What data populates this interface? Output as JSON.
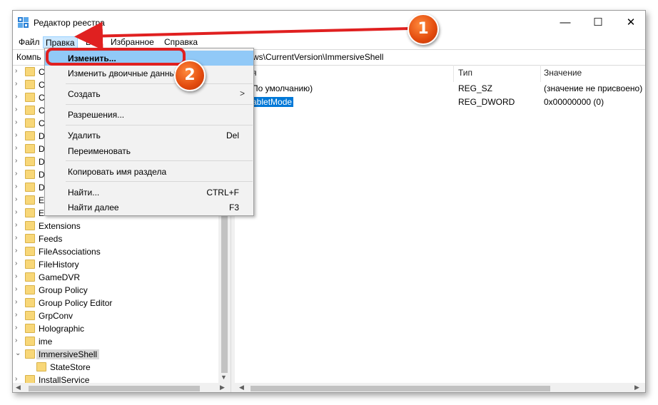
{
  "window": {
    "title": "Редактор реестра",
    "controls": {
      "minimize": "—",
      "maximize": "☐",
      "close": "✕"
    }
  },
  "menu": {
    "items": [
      "Файл",
      "Правка",
      "Вид",
      "Избранное",
      "Справка"
    ],
    "active": "Правка"
  },
  "address": {
    "label": "Компь",
    "path": "ws\\CurrentVersion\\ImmersiveShell"
  },
  "tree": {
    "partial_labels": [
      "C",
      "C",
      "C",
      "C",
      "C",
      "D",
      "D",
      "D",
      "D",
      "D",
      "E",
      "E"
    ],
    "items": [
      {
        "label": "Extensions",
        "expanded": false
      },
      {
        "label": "Feeds",
        "expanded": false
      },
      {
        "label": "FileAssociations",
        "expanded": false
      },
      {
        "label": "FileHistory",
        "expanded": false
      },
      {
        "label": "GameDVR",
        "expanded": false
      },
      {
        "label": "Group Policy",
        "expanded": false
      },
      {
        "label": "Group Policy Editor",
        "expanded": false
      },
      {
        "label": "GrpConv",
        "expanded": false
      },
      {
        "label": "Holographic",
        "expanded": false
      },
      {
        "label": "ime",
        "expanded": false
      },
      {
        "label": "ImmersiveShell",
        "expanded": true,
        "selected": true
      },
      {
        "label": "StateStore",
        "child": true
      },
      {
        "label": "InstallService",
        "expanded": false
      }
    ]
  },
  "list": {
    "columns": [
      "я",
      "Тип",
      "Значение"
    ],
    "rows": [
      {
        "name": "По умолчанию)",
        "type": "REG_SZ",
        "value": "(значение не присвоено)"
      },
      {
        "name": "abletMode",
        "type": "REG_DWORD",
        "value": "0x00000000 (0)",
        "selected": true
      }
    ]
  },
  "dropdown": {
    "items": [
      {
        "label": "Изменить...",
        "shortcut": "",
        "highlight": true
      },
      {
        "label": "Изменить двоичные данны",
        "shortcut": ""
      },
      {
        "label": "Создать",
        "shortcut": "",
        "submenu": ">"
      },
      {
        "label": "Разрешения...",
        "shortcut": ""
      },
      {
        "label": "Удалить",
        "shortcut": "Del"
      },
      {
        "label": "Переименовать",
        "shortcut": ""
      },
      {
        "label": "Копировать имя раздела",
        "shortcut": ""
      },
      {
        "label": "Найти...",
        "shortcut": "CTRL+F"
      },
      {
        "label": "Найти далее",
        "shortcut": "F3"
      }
    ]
  },
  "callouts": {
    "step1": "1",
    "step2": "2"
  },
  "colors": {
    "selection": "#0078d7",
    "menu_highlight": "#cce8ff",
    "callout": "#e24a0d",
    "arrow": "#e02020"
  }
}
